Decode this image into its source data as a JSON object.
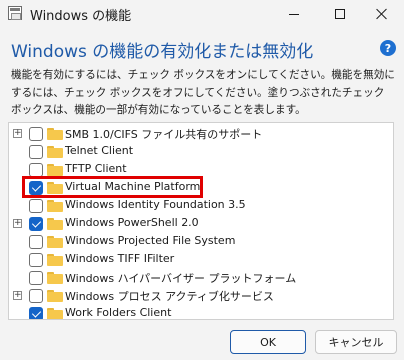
{
  "window": {
    "title": "Windows の機能"
  },
  "heading": "Windows の機能の有効化または無効化",
  "description": "機能を有効にするには、チェック ボックスをオンにしてください。機能を無効にするには、チェック ボックスをオフにしてください。塗りつぶされたチェック ボックスは、機能の一部が有効になっていることを表します。",
  "features": [
    {
      "label": "SMB 1.0/CIFS ファイル共有のサポート",
      "checked": false,
      "expandable": true
    },
    {
      "label": "Telnet Client",
      "checked": false,
      "expandable": false
    },
    {
      "label": "TFTP Client",
      "checked": false,
      "expandable": false
    },
    {
      "label": "Virtual Machine Platform",
      "checked": true,
      "expandable": false
    },
    {
      "label": "Windows Identity Foundation 3.5",
      "checked": false,
      "expandable": false
    },
    {
      "label": "Windows PowerShell 2.0",
      "checked": true,
      "expandable": true
    },
    {
      "label": "Windows Projected File System",
      "checked": false,
      "expandable": false
    },
    {
      "label": "Windows TIFF IFilter",
      "checked": false,
      "expandable": false
    },
    {
      "label": "Windows ハイパーバイザー プラットフォーム",
      "checked": false,
      "expandable": false
    },
    {
      "label": "Windows プロセス アクティブ化サービス",
      "checked": false,
      "expandable": true
    },
    {
      "label": "Work Folders Client",
      "checked": true,
      "expandable": false
    }
  ],
  "buttons": {
    "ok": "OK",
    "cancel": "キャンセル"
  },
  "colors": {
    "heading": "#1f5aa8",
    "checkbox_checked": "#1464c8",
    "highlight": "#e00000",
    "folder": "#f6c84c"
  }
}
